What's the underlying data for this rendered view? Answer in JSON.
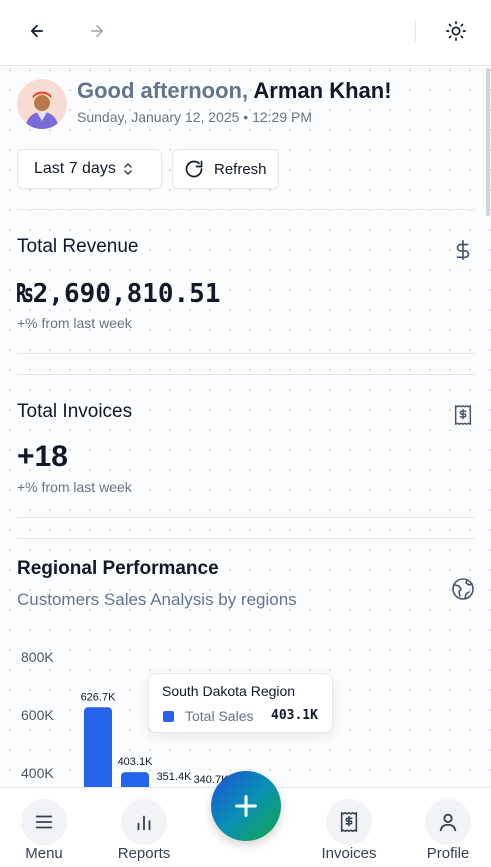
{
  "header": {
    "back_icon": "arrow-left-icon",
    "forward_icon": "arrow-right-icon",
    "theme_icon": "sun-icon"
  },
  "greeting": {
    "salutation": "Good afternoon,",
    "name": "Arman Khan!",
    "datetime": "Sunday, January 12, 2025 • 12:29 PM"
  },
  "controls": {
    "range_label": "Last 7 days",
    "refresh_label": "Refresh"
  },
  "revenue": {
    "title": "Total Revenue",
    "value": "₨2,690,810.51",
    "change": "+% from last week",
    "icon": "dollar-icon"
  },
  "invoices": {
    "title": "Total Invoices",
    "value": "+18",
    "change": "+% from last week",
    "icon": "receipt-icon"
  },
  "regional": {
    "title": "Regional Performance",
    "subtitle": "Customers Sales Analysis by regions",
    "icon": "globe-icon",
    "tooltip": {
      "title": "South Dakota Region",
      "label": "Total Sales",
      "value": "403.1K"
    }
  },
  "chart_data": {
    "type": "bar",
    "series": [
      {
        "values": [
          626.7,
          403.1,
          351.4,
          340.7
        ]
      }
    ],
    "data_labels": [
      "626.7K",
      "403.1K",
      "351.4K",
      "340.7K"
    ],
    "yticks": [
      "800K",
      "600K",
      "400K"
    ],
    "ylim": [
      0,
      800
    ],
    "color": "#2563eb"
  },
  "bottom_nav": {
    "menu": "Menu",
    "reports": "Reports",
    "invoices": "Invoices",
    "profile": "Profile"
  }
}
